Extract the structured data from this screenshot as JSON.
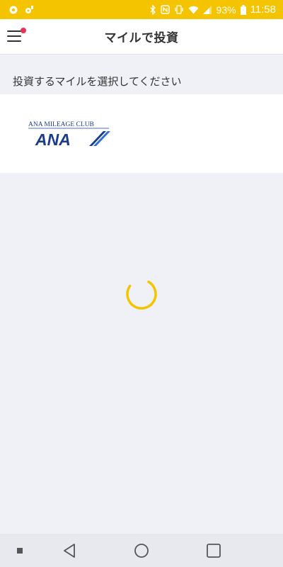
{
  "status_bar": {
    "battery_percent": "93%",
    "time": "11:58",
    "background_color": "#f5c400",
    "icons_left": [
      "settings-icon",
      "sim-icon"
    ],
    "icons_right": [
      "bluetooth-icon",
      "nfc-icon",
      "vibrate-icon",
      "wifi-icon",
      "signal-icon",
      "battery-icon"
    ]
  },
  "header": {
    "title": "マイルで投資",
    "menu_icon": "hamburger-menu-icon",
    "notification_dot_color": "#e8335a"
  },
  "main": {
    "section_label": "投資するマイルを選択してください",
    "options": [
      {
        "logo_caption": "ANA MILEAGE CLUB",
        "logo_text": "ANA",
        "logo_color": "#1a3c8c"
      }
    ],
    "loading": true,
    "spinner_color": "#f5c400"
  },
  "nav_bar": {
    "buttons": [
      "recents-dot-icon",
      "back-icon",
      "home-icon",
      "overview-icon"
    ]
  }
}
